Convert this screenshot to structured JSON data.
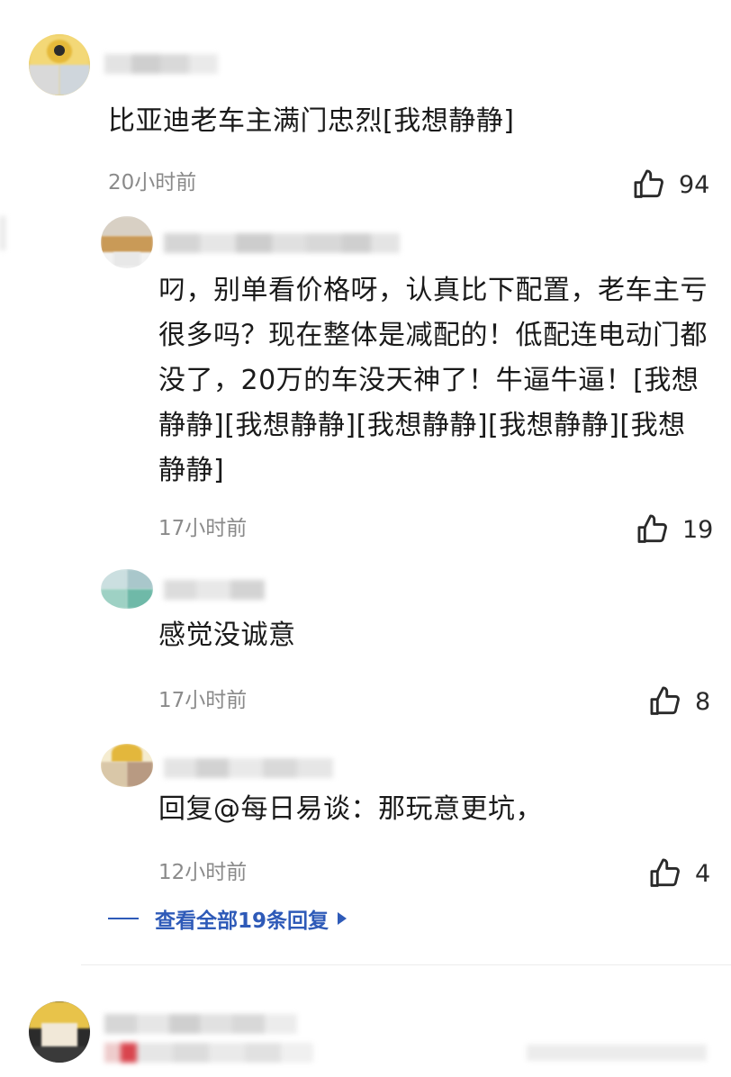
{
  "comment": {
    "text": "比亚迪老车主满门忠烈[我想静静]",
    "time": "20小时前",
    "likes": "94"
  },
  "replies": [
    {
      "text": "叼，别单看价格呀，认真比下配置，老车主亏很多吗？现在整体是减配的！低配连电动门都没了，20万的车没天神了！牛逼牛逼！[我想静静][我想静静][我想静静][我想静静][我想静静]",
      "time": "17小时前",
      "likes": "19"
    },
    {
      "text": "感觉没诚意",
      "time": "17小时前",
      "likes": "8"
    },
    {
      "text": "回复@每日易谈：那玩意更坑，",
      "time": "12小时前",
      "likes": "4"
    }
  ],
  "view_all_label": "查看全部19条回复",
  "icons": {
    "like": "thumbs-up-icon",
    "expand": "triangle-right-icon"
  },
  "colors": {
    "link": "#2e5ab8",
    "meta": "#8a8a8a",
    "text": "#1a1a1a"
  }
}
